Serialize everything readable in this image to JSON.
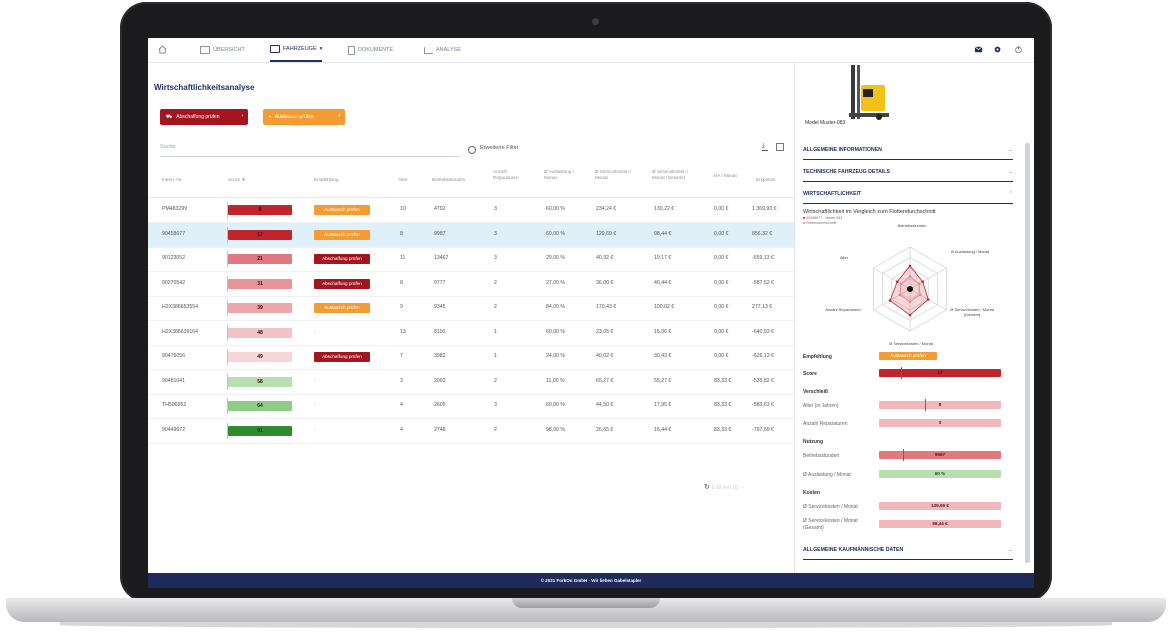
{
  "nav": {
    "items": [
      {
        "label": "ÜBERSICHT",
        "active": false
      },
      {
        "label": "FAHRZEUGE",
        "active": true
      },
      {
        "label": "DOKUMENTE",
        "active": false
      },
      {
        "label": "ANALYSE",
        "active": false
      }
    ],
    "icons": [
      "home-icon",
      "monitor-icon",
      "forklift-icon",
      "document-icon",
      "chart-icon",
      "mail-icon",
      "gear-icon",
      "power-icon"
    ]
  },
  "page": {
    "title": "Wirtschaftlichkeitsanalyse"
  },
  "actions": {
    "primary": "Abschaffung prüfen",
    "secondary": "Austausch prüfen"
  },
  "search": {
    "placeholder": "Suche",
    "filter_label": "Erweiterte Filter"
  },
  "table": {
    "headers": [
      "Intern.-Nr.",
      "Score",
      "Empfehlung",
      "Alter",
      "Betriebsstunden",
      "Anzahl Reparaturen",
      "Ø Auslastung / Monat",
      "Ø Servicekosten / Monat",
      "Ø Servicekosten / Monat (Gesamt)",
      "AfA / Monat",
      "Ersparnis"
    ],
    "rows": [
      {
        "id": "PM483299",
        "score": "8",
        "score_color": "#c0242d",
        "recommendation": "Austausch prüfen",
        "rec_type": "orange",
        "alter": "10",
        "hours": "4792",
        "repairs": "3",
        "util": "60,00 %",
        "svc": "234,24 €",
        "svc_total": "130,22 €",
        "afa": "0,00 €",
        "savings": "1.369,93 €",
        "selected": false
      },
      {
        "id": "90458677",
        "score": "17",
        "score_color": "#c0242d",
        "recommendation": "Austausch prüfen",
        "rec_type": "orange",
        "alter": "8",
        "hours": "9987",
        "repairs": "3",
        "util": "60,00 %",
        "svc": "129,69 €",
        "svc_total": "98,44 €",
        "afa": "0,00 €",
        "savings": "856,32 €",
        "selected": true
      },
      {
        "id": "90123052",
        "score": "21",
        "score_color": "#e07a80",
        "recommendation": "Abschaffung prüfen",
        "rec_type": "red",
        "alter": "11",
        "hours": "13467",
        "repairs": "3",
        "util": "29,00 %",
        "svc": "40,32 €",
        "svc_total": "19,17 €",
        "afa": "0,00 €",
        "savings": "-659,13 €",
        "selected": false
      },
      {
        "id": "90270542",
        "score": "31",
        "score_color": "#e89599",
        "recommendation": "Abschaffung prüfen",
        "rec_type": "red",
        "alter": "8",
        "hours": "9777",
        "repairs": "2",
        "util": "27,00 %",
        "svc": "36,00 €",
        "svc_total": "40,44 €",
        "afa": "0,00 €",
        "savings": "-587,52 €",
        "selected": false
      },
      {
        "id": "H2X386653554",
        "score": "39",
        "score_color": "#eba7aa",
        "recommendation": "Austausch prüfen",
        "rec_type": "orange",
        "alter": "9",
        "hours": "9345",
        "repairs": "2",
        "util": "84,00 %",
        "svc": "170,43 €",
        "svc_total": "100,02 €",
        "afa": "0,00 €",
        "savings": "277,13 €",
        "selected": false
      },
      {
        "id": "H2X386639164",
        "score": "48",
        "score_color": "#f2c4c6",
        "recommendation": "-",
        "rec_type": "none",
        "alter": "13",
        "hours": "8116",
        "repairs": "1",
        "util": "60,00 %",
        "svc": "23,05 €",
        "svc_total": "15,06 €",
        "afa": "0,00 €",
        "savings": "-640,93 €",
        "selected": false
      },
      {
        "id": "90476056",
        "score": "49",
        "score_color": "#f6d6d7",
        "recommendation": "Abschaffung prüfen",
        "rec_type": "red",
        "alter": "7",
        "hours": "3982",
        "repairs": "1",
        "util": "24,00 %",
        "svc": "40,02 €",
        "svc_total": "30,43 €",
        "afa": "0,00 €",
        "savings": "-626,13 €",
        "selected": false
      },
      {
        "id": "90481041",
        "score": "58",
        "score_color": "#b9dfb1",
        "recommendation": "-",
        "rec_type": "none",
        "alter": "3",
        "hours": "2092",
        "repairs": "2",
        "util": "11,00 %",
        "svc": "65,27 €",
        "svc_total": "55,27 €",
        "afa": "83,33 €",
        "savings": "-535,82 €",
        "selected": false
      },
      {
        "id": "TH506952",
        "score": "64",
        "score_color": "#8fcd86",
        "recommendation": "-",
        "rec_type": "none",
        "alter": "4",
        "hours": "2605",
        "repairs": "3",
        "util": "60,00 %",
        "svc": "44,50 €",
        "svc_total": "17,95 €",
        "afa": "83,33 €",
        "savings": "-583,63 €",
        "selected": false
      },
      {
        "id": "90449672",
        "score": "91",
        "score_color": "#2e8b2e",
        "recommendation": "-",
        "rec_type": "none",
        "alter": "4",
        "hours": "2748",
        "repairs": "2",
        "util": "98,00 %",
        "svc": "26,65 €",
        "svc_total": "16,44 €",
        "afa": "83,33 €",
        "savings": "-797,69 €",
        "selected": false
      }
    ],
    "pager": "1-10 von 10"
  },
  "detail": {
    "model": "Model Muster-083",
    "sections": {
      "general": "ALLGEMEINE INFORMATIONEN",
      "technical": "TECHNISCHE FAHRZEUG DETAILS",
      "economic": "WIRTSCHAFTLICHKEIT",
      "commercial": "ALLGEMEINE KAUFMÄNNISCHE DATEN"
    },
    "chart_title": "Wirtschaftlichkeit im Vergleich zum Flottendurchschnitt",
    "legend": [
      "90458677 - Model 083",
      "Flottendurchschnitt"
    ],
    "recommendation_label": "Empfehlung",
    "recommendation_value": "Austausch prüfen",
    "score_label": "Score",
    "score_value": "17",
    "groups": {
      "wear": "Verschleiß",
      "usage": "Nutzung",
      "costs": "Kosten"
    },
    "metrics": {
      "age_label": "Alter (in Jahren)",
      "age_value": "8",
      "repairs_label": "Anzahl Reparaturen",
      "repairs_value": "3",
      "hours_label": "Betriebsstunden",
      "hours_value": "9987",
      "util_label": "Ø Auslastung / Monat",
      "util_value": "60 %",
      "svc_label": "Ø Servicekosten / Monat",
      "svc_value": "129,69 €",
      "svc_total_label": "Ø Servicekosten / Monat (Gesamt)",
      "svc_total_value": "98,44 €"
    }
  },
  "chart_data": {
    "type": "radar",
    "axes": [
      "Betriebsstunden",
      "Ø Auslastung / Monat",
      "Ø Servicekosten / Monat (Gesamt)",
      "Ø Servicekosten / Monat",
      "Anzahl Reparaturen",
      "Alter"
    ],
    "series": [
      {
        "name": "90458677 - Model 083",
        "values": [
          0.55,
          0.35,
          0.5,
          0.62,
          0.55,
          0.35
        ]
      },
      {
        "name": "Flottendurchschnitt",
        "values": [
          0.3,
          0.25,
          0.28,
          0.3,
          0.28,
          0.25
        ]
      }
    ],
    "colors": [
      "#c0242d",
      "#e08a8f"
    ]
  },
  "footer": {
    "text": "© 2021 ForkOn GmbH · Wir lieben Gabelstapler"
  },
  "colors": {
    "brand": "#1e2f66",
    "danger": "#a3161f",
    "warning": "#f39c34",
    "selected_row": "#dff0fb"
  }
}
